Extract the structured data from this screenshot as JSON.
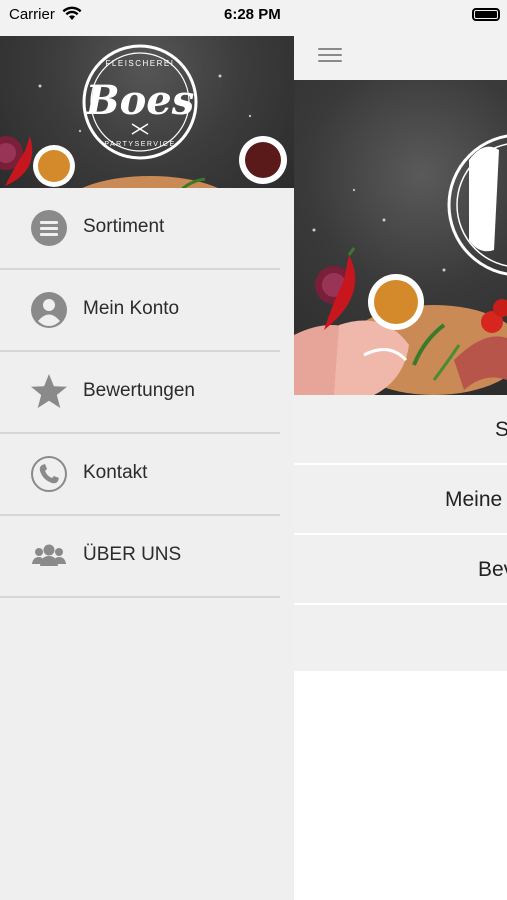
{
  "status_bar": {
    "carrier": "Carrier",
    "time": "6:28 PM"
  },
  "drawer": {
    "logo": {
      "brand": "Boes",
      "top_text": "FLEISCHEREI",
      "bottom_text": "PARTYSERVICE"
    },
    "menu_items": [
      {
        "label": "Sortiment",
        "icon": "list-icon"
      },
      {
        "label": "Mein Konto",
        "icon": "account-icon"
      },
      {
        "label": "Bewertungen",
        "icon": "star-icon"
      },
      {
        "label": "Kontakt",
        "icon": "phone-icon"
      },
      {
        "label": "ÜBER UNS",
        "icon": "group-icon"
      }
    ]
  },
  "main": {
    "menu_items_partial": [
      {
        "label": "S"
      },
      {
        "label": "Meine"
      },
      {
        "label": "Bev"
      }
    ]
  },
  "colors": {
    "drawer_bg": "#efefef",
    "icon_gray": "#8a8a8a",
    "divider": "#d6d6d6",
    "text": "#2b2b2b"
  }
}
